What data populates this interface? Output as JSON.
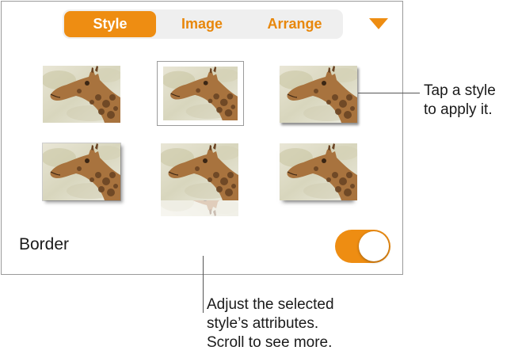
{
  "tabs": [
    {
      "label": "Style",
      "active": true
    },
    {
      "label": "Image",
      "active": false
    },
    {
      "label": "Arrange",
      "active": false
    }
  ],
  "menu_icon": "triangle-down-icon",
  "style_presets": [
    {
      "id": "plain"
    },
    {
      "id": "thin-border"
    },
    {
      "id": "drop-shadow"
    },
    {
      "id": "picture-frame"
    },
    {
      "id": "reflection"
    },
    {
      "id": "curved-shadow"
    }
  ],
  "border": {
    "label": "Border",
    "enabled": true
  },
  "callouts": {
    "styles": [
      "Tap a style",
      "to apply it."
    ],
    "attributes": [
      "Adjust the selected",
      "style’s attributes.",
      "Scroll to see more."
    ]
  },
  "colors": {
    "accent": "#ee8d12",
    "panel_border": "#9a9a9a",
    "segment_bg": "#efefef"
  }
}
